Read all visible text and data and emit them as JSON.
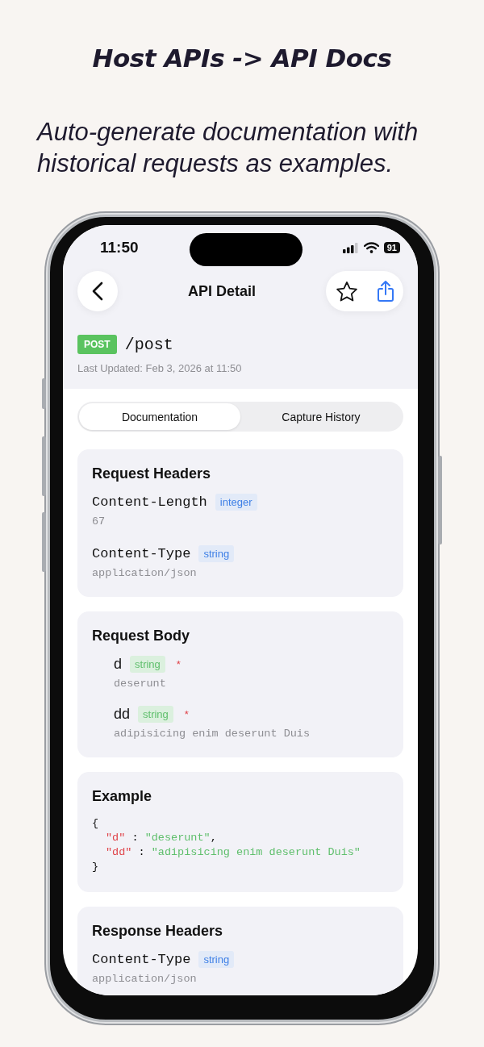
{
  "heading": "Host APIs -> API Docs",
  "subtitle": "Auto-generate documentation with historical requests as examples.",
  "status_bar": {
    "time": "11:50",
    "battery": "91"
  },
  "nav": {
    "title": "API Detail",
    "starred": false
  },
  "endpoint": {
    "method": "POST",
    "path": "/post",
    "last_updated": "Last Updated: Feb 3, 2026 at 11:50"
  },
  "segments": [
    {
      "label": "Documentation",
      "selected": true
    },
    {
      "label": "Capture History",
      "selected": false
    }
  ],
  "sections": [
    {
      "kind": "headers",
      "title": "Request Headers",
      "items": [
        {
          "name": "Content-Length",
          "type": "integer",
          "value": "67"
        },
        {
          "name": "Content-Type",
          "type": "string",
          "value": "application/json"
        }
      ]
    },
    {
      "kind": "body",
      "title": "Request Body",
      "items": [
        {
          "name": "d",
          "type": "string",
          "required_mark": "*",
          "value": "deserunt"
        },
        {
          "name": "dd",
          "type": "string",
          "required_mark": "*",
          "value": "adipisicing enim deserunt Duis"
        }
      ]
    },
    {
      "kind": "example",
      "title": "Example",
      "lines": [
        {
          "indent": false,
          "tokens": [
            {
              "kind": "punct",
              "text": "{"
            }
          ]
        },
        {
          "indent": true,
          "tokens": [
            {
              "kind": "key",
              "text": "\"d\""
            },
            {
              "kind": "punct",
              "text": " : "
            },
            {
              "kind": "string",
              "text": "\"deserunt\""
            },
            {
              "kind": "punct",
              "text": ","
            }
          ]
        },
        {
          "indent": true,
          "tokens": [
            {
              "kind": "key",
              "text": "\"dd\""
            },
            {
              "kind": "punct",
              "text": " : "
            },
            {
              "kind": "string",
              "text": "\"adipisicing enim deserunt Duis\""
            }
          ]
        },
        {
          "indent": false,
          "tokens": [
            {
              "kind": "punct",
              "text": "}"
            }
          ]
        }
      ]
    },
    {
      "kind": "headers",
      "title": "Response Headers",
      "items": [
        {
          "name": "Content-Type",
          "type": "string",
          "value": "application/json"
        }
      ]
    }
  ]
}
